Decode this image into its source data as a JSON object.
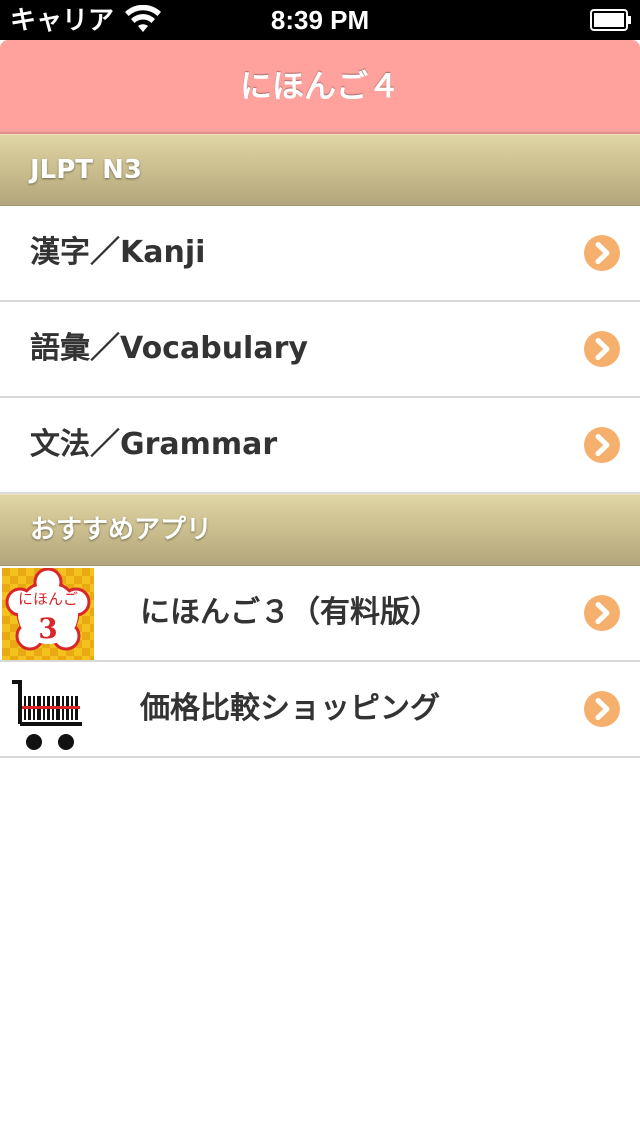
{
  "status_bar": {
    "carrier": "キャリア",
    "time": "8:39 PM",
    "wifi_icon": "wifi-icon",
    "battery_icon": "battery-icon"
  },
  "nav": {
    "title": "にほんご４"
  },
  "sections": [
    {
      "title": "JLPT N3",
      "rows": [
        {
          "label": "漢字／Kanji",
          "icon": "chevron-right-icon"
        },
        {
          "label": "語彙／Vocabulary",
          "icon": "chevron-right-icon"
        },
        {
          "label": "文法／Grammar",
          "icon": "chevron-right-icon"
        }
      ]
    },
    {
      "title": "おすすめアプリ",
      "rows": [
        {
          "label": "にほんご３（有料版）",
          "app_icon": "nihongo-3-app-icon",
          "icon_text_top": "にほんご",
          "icon_text_number": "3",
          "icon": "chevron-right-icon"
        },
        {
          "label": "価格比較ショッピング",
          "app_icon": "shopping-cart-barcode-icon",
          "icon": "chevron-right-icon"
        }
      ]
    }
  ],
  "colors": {
    "nav_background": "#ffa29e",
    "section_gradient_top": "#e0d5a4",
    "section_gradient_bottom": "#b2a67c",
    "chevron": "#f6b06e",
    "row_text": "#333333",
    "divider": "#d9d9d9"
  }
}
